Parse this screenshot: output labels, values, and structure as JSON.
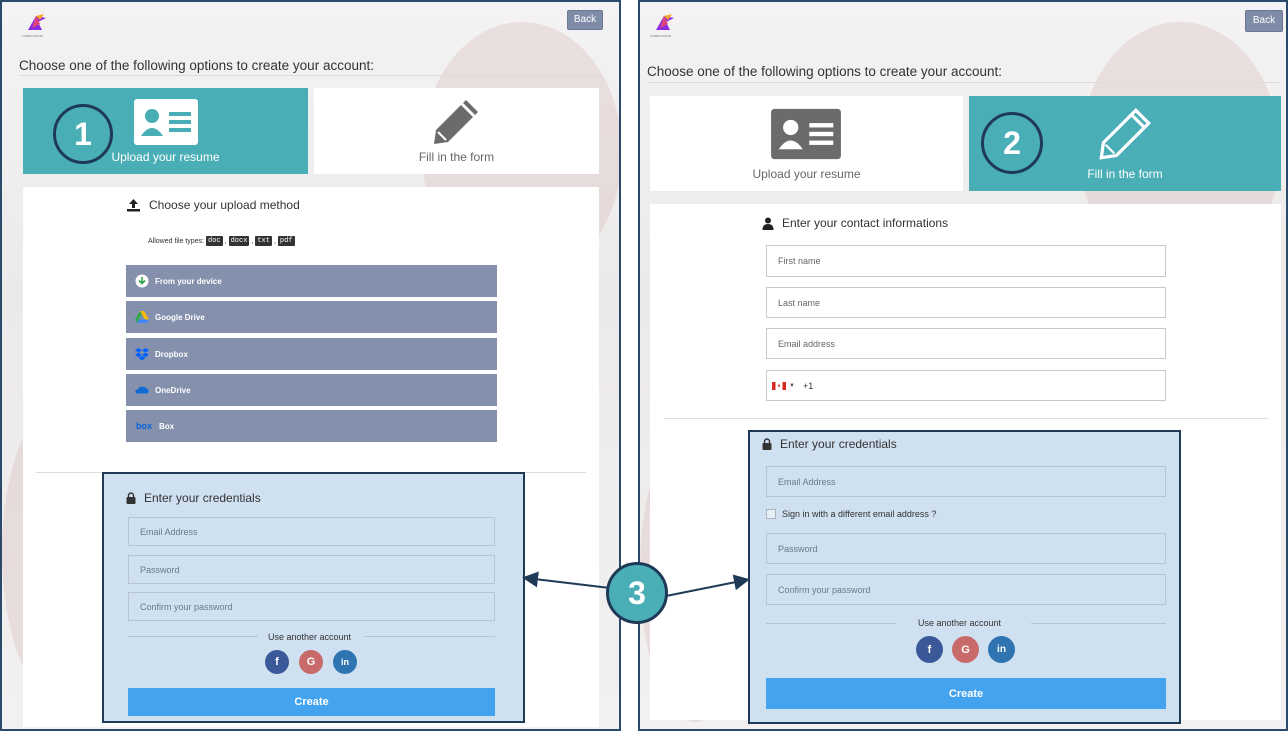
{
  "left": {
    "back_label": "Back",
    "logo_text": "LOREM IPSUM",
    "choose_text": "Choose one of the following options to create your account:",
    "tile_upload": "Upload your resume",
    "tile_form": "Fill in the form",
    "step_badge": "1",
    "upload_heading": "Choose your upload method",
    "allowed_label": "Allowed file types:",
    "file_types": [
      "doc",
      "docx",
      "txt",
      "pdf"
    ],
    "sources": [
      "From your device",
      "Google Drive",
      "Dropbox",
      "OneDrive",
      "Box"
    ],
    "cred_heading": "Enter your credentials",
    "email_placeholder": "Email Address",
    "password_placeholder": "Password",
    "confirm_placeholder": "Confirm your password",
    "use_another": "Use another account",
    "create_label": "Create"
  },
  "right": {
    "back_label": "Back",
    "logo_text": "LOREM IPSUM",
    "choose_text": "Choose one of the following options to create your account:",
    "tile_upload": "Upload your resume",
    "tile_form": "Fill in the form",
    "step_badge": "2",
    "contact_heading": "Enter your contact informations",
    "first_name": "First name",
    "last_name": "Last name",
    "email_address": "Email address",
    "phone_code": "+1",
    "cred_heading": "Enter your credentials",
    "email_placeholder": "Email Address",
    "different_email": "Sign in with a different email address ?",
    "password_placeholder": "Password",
    "confirm_placeholder": "Confirm your password",
    "use_another": "Use another account",
    "create_label": "Create"
  },
  "connector_badge": "3",
  "social": {
    "facebook": "f",
    "google": "G",
    "linkedin": "in"
  },
  "colors": {
    "accent": "#4aaeb6",
    "source_button": "#8590ad",
    "create": "#43a3ee",
    "cred_bg": "#cfe0f1",
    "frame": "#1f3a57"
  }
}
